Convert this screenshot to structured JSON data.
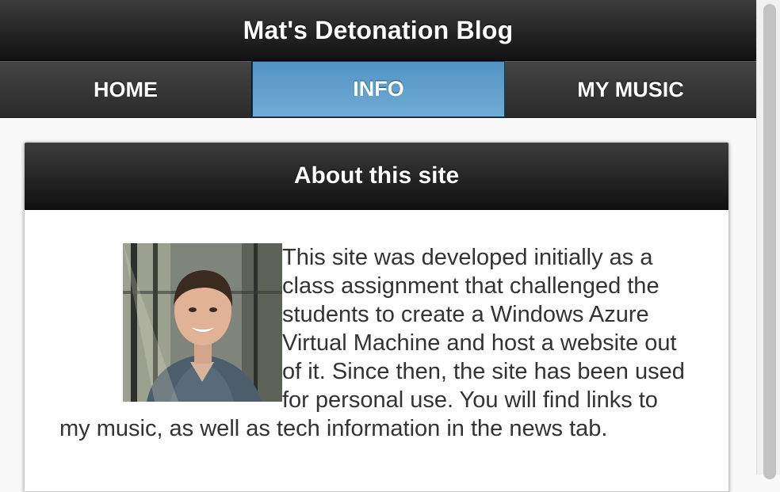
{
  "header": {
    "title": "Mat's Detonation Blog"
  },
  "nav": {
    "tabs": [
      {
        "label": "HOME",
        "active": false
      },
      {
        "label": "INFO",
        "active": true
      },
      {
        "label": "MY MUSIC",
        "active": false
      }
    ]
  },
  "about": {
    "heading": "About this site",
    "photo_icon": "profile-photo",
    "text": "This site was developed initially as a class assignment that challenged the students to create a Windows Azure Virtual Machine and host a website out of it. Since then, the site has been used for personal use. You will find links to my music, as well as tech information in the news tab."
  },
  "colors": {
    "bar_dark": "#111111",
    "active_tab": "#5e9fd0",
    "text": "#333333",
    "page_bg": "#f9f9f9"
  }
}
